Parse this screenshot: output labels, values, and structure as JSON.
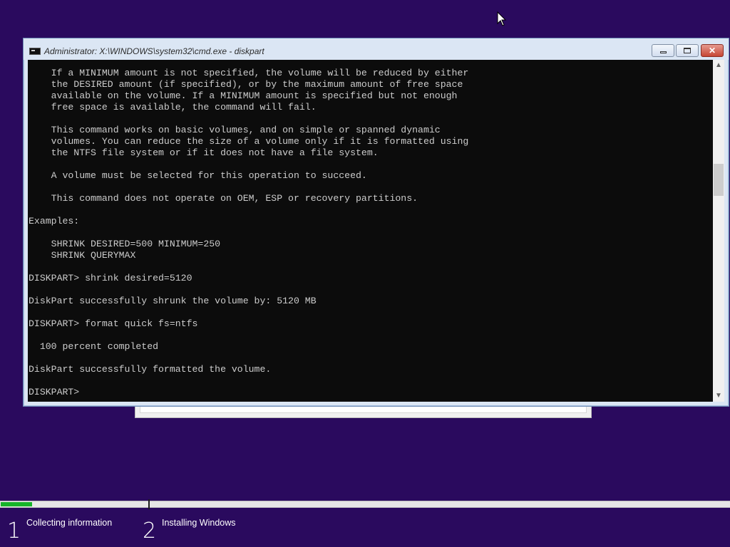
{
  "window": {
    "title": "Administrator: X:\\WINDOWS\\system32\\cmd.exe - diskpart",
    "minimize_icon": "minimize-icon",
    "maximize_icon": "maximize-icon",
    "close_icon": "close-icon",
    "close_glyph": "✕"
  },
  "console": {
    "lines": [
      "    If a MINIMUM amount is not specified, the volume will be reduced by either",
      "    the DESIRED amount (if specified), or by the maximum amount of free space",
      "    available on the volume. If a MINIMUM amount is specified but not enough",
      "    free space is available, the command will fail.",
      "",
      "    This command works on basic volumes, and on simple or spanned dynamic",
      "    volumes. You can reduce the size of a volume only if it is formatted using",
      "    the NTFS file system or if it does not have a file system.",
      "",
      "    A volume must be selected for this operation to succeed.",
      "",
      "    This command does not operate on OEM, ESP or recovery partitions.",
      "",
      "Examples:",
      "",
      "    SHRINK DESIRED=500 MINIMUM=250",
      "    SHRINK QUERYMAX",
      "",
      "DISKPART> shrink desired=5120",
      "",
      "DiskPart successfully shrunk the volume by: 5120 MB",
      "",
      "DISKPART> format quick fs=ntfs",
      "",
      "  100 percent completed",
      "",
      "DiskPart successfully formatted the volume.",
      "",
      "DISKPART>"
    ]
  },
  "scrollbar": {
    "up_glyph": "▲",
    "down_glyph": "▼"
  },
  "setup_progress": {
    "fill_fraction": 0.043,
    "steps": [
      {
        "number": "1",
        "label": "Collecting information"
      },
      {
        "number": "2",
        "label": "Installing Windows"
      }
    ]
  },
  "colors": {
    "desktop_background": "#2a0a5e",
    "console_background": "#0c0c0c",
    "console_text": "#cccccc",
    "progress_fill": "#17b32a"
  }
}
